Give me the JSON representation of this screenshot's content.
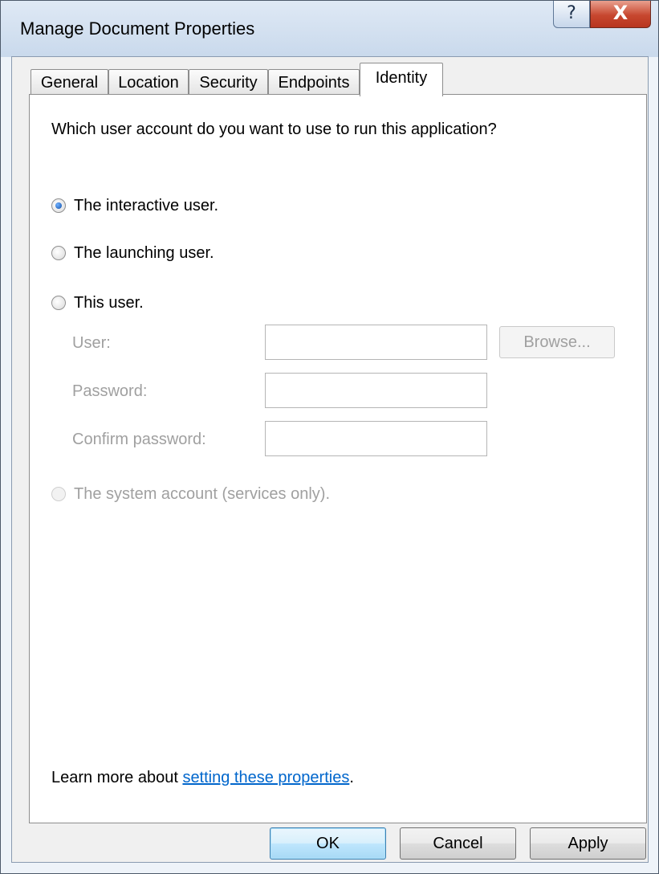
{
  "window": {
    "title": "Manage Document Properties",
    "help_glyph": "?",
    "close_glyph": "X"
  },
  "tabs": [
    {
      "label": "General",
      "active": false
    },
    {
      "label": "Location",
      "active": false
    },
    {
      "label": "Security",
      "active": false
    },
    {
      "label": "Endpoints",
      "active": false
    },
    {
      "label": "Identity",
      "active": true
    }
  ],
  "identity": {
    "prompt": "Which user account do you want to use to run this application?",
    "options": [
      {
        "label": "The interactive user.",
        "checked": true,
        "enabled": true
      },
      {
        "label": "The launching user.",
        "checked": false,
        "enabled": true
      },
      {
        "label": "This user.",
        "checked": false,
        "enabled": true
      },
      {
        "label": "The system account (services only).",
        "checked": false,
        "enabled": false
      }
    ],
    "fields": {
      "user_label": "User:",
      "user_value": "",
      "password_label": "Password:",
      "password_value": "",
      "confirm_label": "Confirm password:",
      "confirm_value": ""
    },
    "browse_label": "Browse..."
  },
  "learn_more": {
    "prefix": "Learn more about ",
    "link": "setting these properties",
    "suffix": "."
  },
  "buttons": {
    "ok": "OK",
    "cancel": "Cancel",
    "apply": "Apply"
  },
  "colors": {
    "link": "#0066cc",
    "disabled_text": "#a0a0a0",
    "close_button": "#c7472f"
  }
}
